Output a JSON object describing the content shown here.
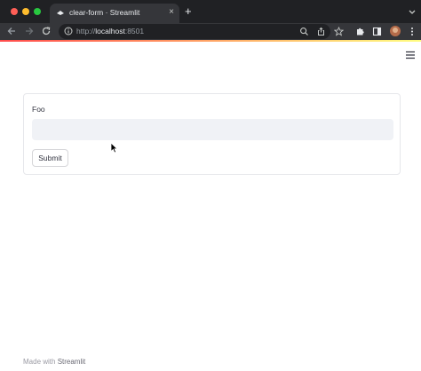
{
  "browser": {
    "tab_title": "clear-form · Streamlit",
    "tab_close": "×",
    "new_tab": "+",
    "url_scheme": "http://",
    "url_host": "localhost",
    "url_port": ":8501"
  },
  "colors": {
    "chrome_dark": "#202124",
    "chrome_toolbar": "#35363a",
    "accent_start": "#ff4b4b",
    "accent_end": "#fffd80",
    "input_bg": "#f0f2f6",
    "text": "#31333f"
  },
  "icons": {
    "back": "back-arrow-icon",
    "forward": "forward-arrow-icon",
    "reload": "reload-icon",
    "site_info": "info-icon",
    "zoom": "zoom-icon",
    "share": "share-icon",
    "bookmark": "star-icon",
    "extensions": "puzzle-icon",
    "sidebar": "sidebar-icon",
    "profile": "avatar",
    "menu": "kebab-menu-icon",
    "app_menu": "hamburger-icon"
  },
  "form": {
    "label": "Foo",
    "value": "",
    "submit_label": "Submit"
  },
  "footer": {
    "made_with": "Made with ",
    "brand": "Streamlit"
  }
}
